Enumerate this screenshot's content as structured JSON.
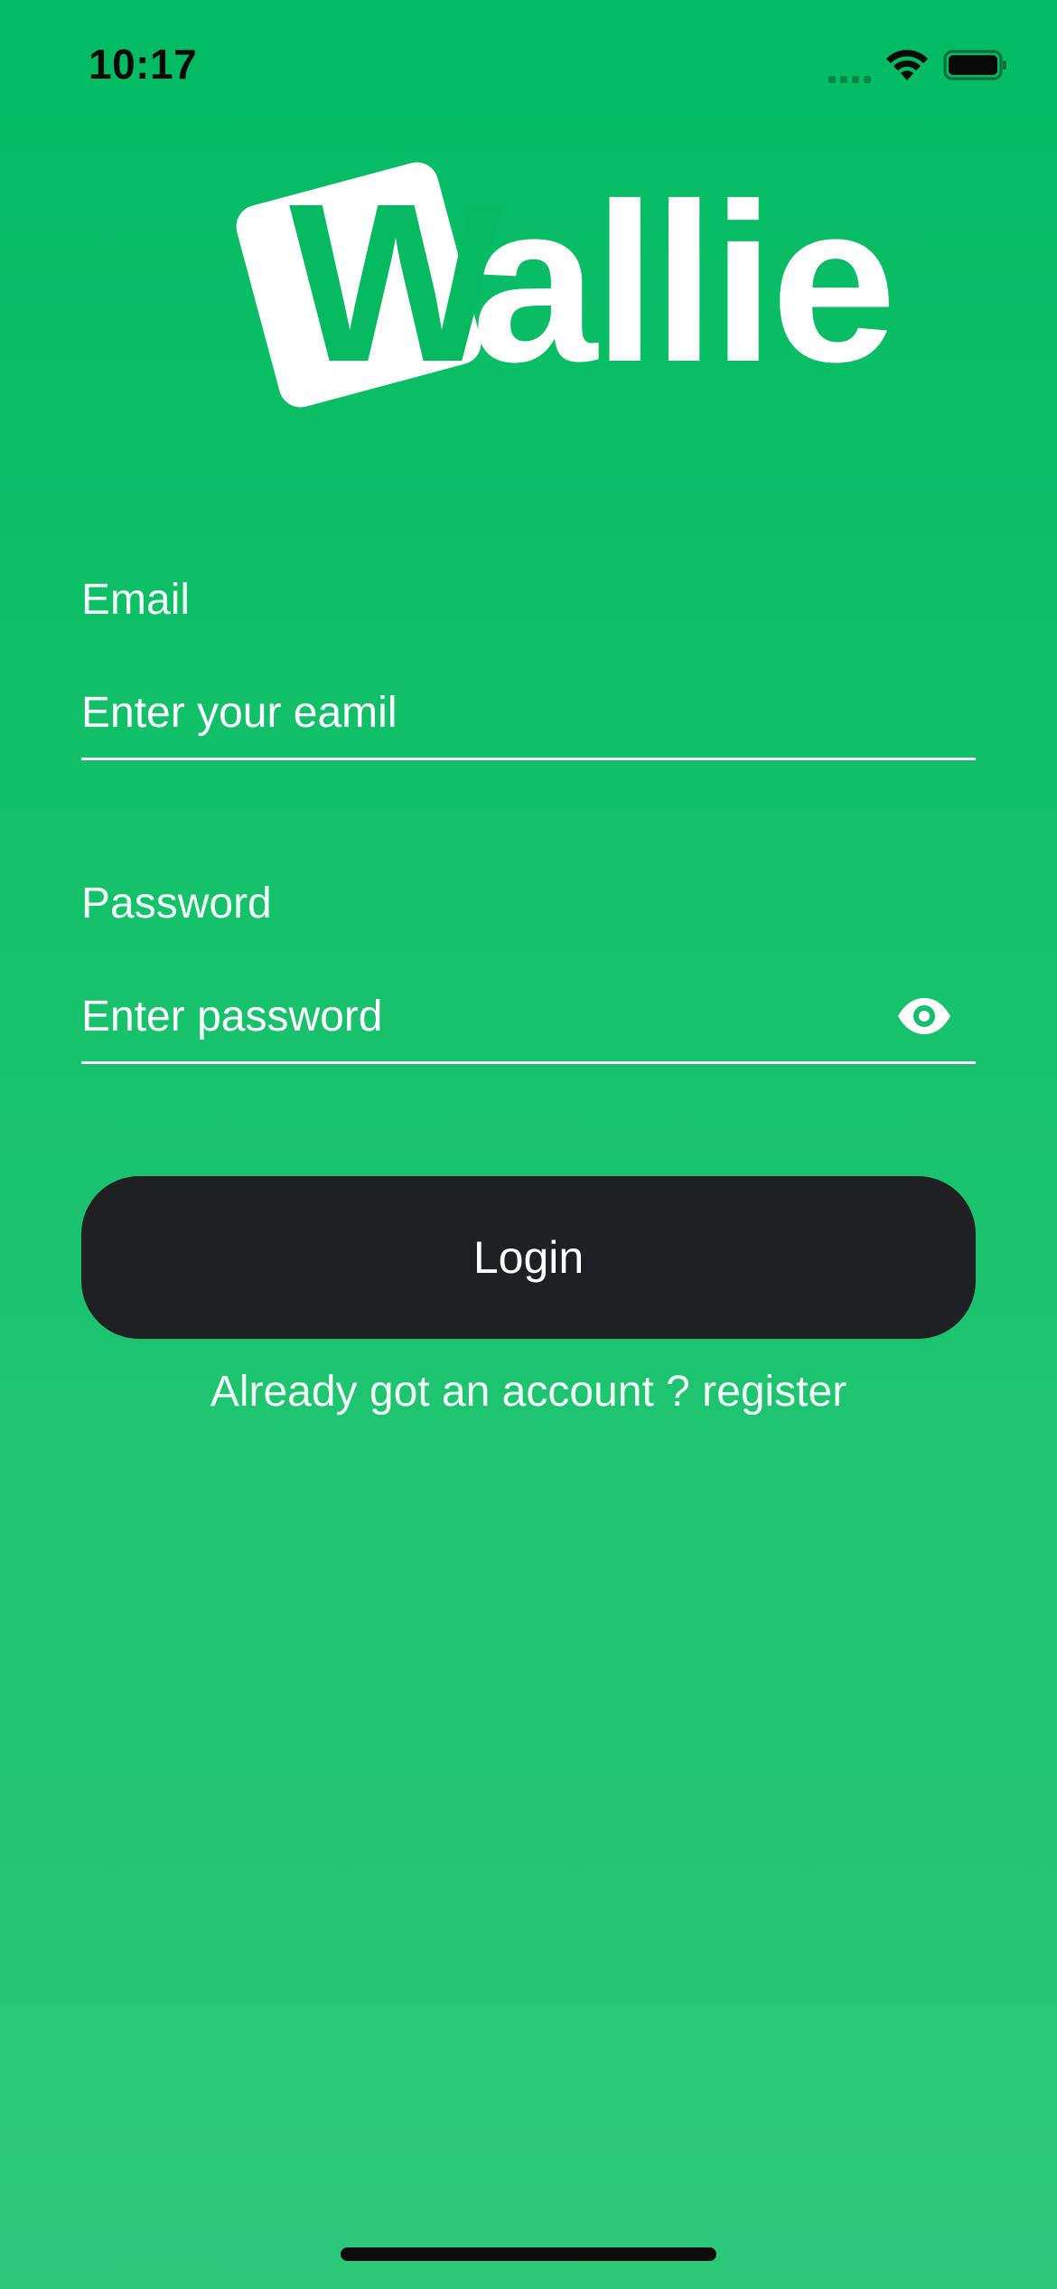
{
  "status_bar": {
    "time": "10:17",
    "icons": [
      "cellular-signal-icon",
      "wifi-icon",
      "battery-icon"
    ]
  },
  "logo": {
    "letter": "W",
    "rest": "allie",
    "full_text": "Wallie"
  },
  "form": {
    "email": {
      "label": "Email",
      "placeholder": "Enter your eamil",
      "value": ""
    },
    "password": {
      "label": "Password",
      "placeholder": "Enter password",
      "value": "",
      "toggle_icon": "eye-icon"
    },
    "login_button_label": "Login",
    "register_link_text": "Already got an account ? register"
  },
  "colors": {
    "background_top": "#02BB62",
    "background_bottom": "#2BC878",
    "button": "#1F2024",
    "text": "#FFFFFF"
  }
}
